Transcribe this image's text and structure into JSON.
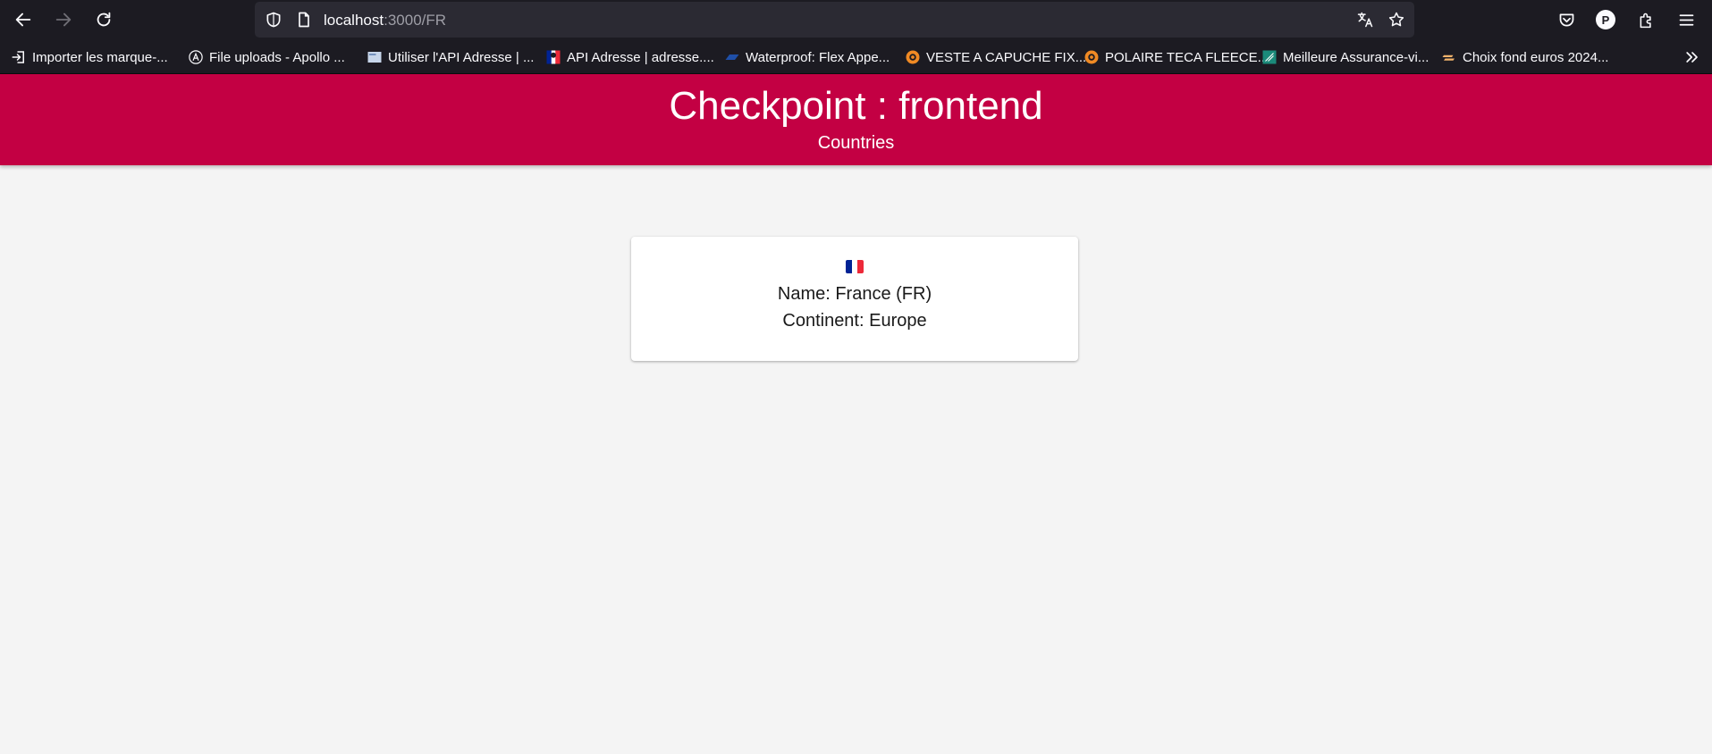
{
  "browser": {
    "url_host": "localhost",
    "url_path": ":3000/FR",
    "profile_initial": "P",
    "bookmarks": [
      {
        "label": "Importer les marque-...",
        "icon": "import-icon"
      },
      {
        "label": "File uploads - Apollo ...",
        "icon": "apollo-icon"
      },
      {
        "label": "Utiliser l'API Adresse | ...",
        "icon": "site-thumbnail-icon"
      },
      {
        "label": "API Adresse | adresse....",
        "icon": "marianne-icon"
      },
      {
        "label": "Waterproof: Flex Appe...",
        "icon": "brand-icon"
      },
      {
        "label": "VESTE A CAPUCHE FIX...",
        "icon": "shop-icon"
      },
      {
        "label": "POLAIRE TECA FLEECE...",
        "icon": "shop-icon"
      },
      {
        "label": "Meilleure Assurance-vi...",
        "icon": "finance-icon"
      },
      {
        "label": "Choix fond euros 2024...",
        "icon": "finance-icon"
      }
    ]
  },
  "header": {
    "title": "Checkpoint : frontend",
    "subtitle": "Countries"
  },
  "country": {
    "name_line": "Name: France (FR)",
    "continent_line": "Continent: Europe",
    "flag_colors": [
      "#002395",
      "#ffffff",
      "#ed2939"
    ]
  },
  "colors": {
    "header_bg": "#c30043",
    "page_bg": "#f4f4f4"
  }
}
